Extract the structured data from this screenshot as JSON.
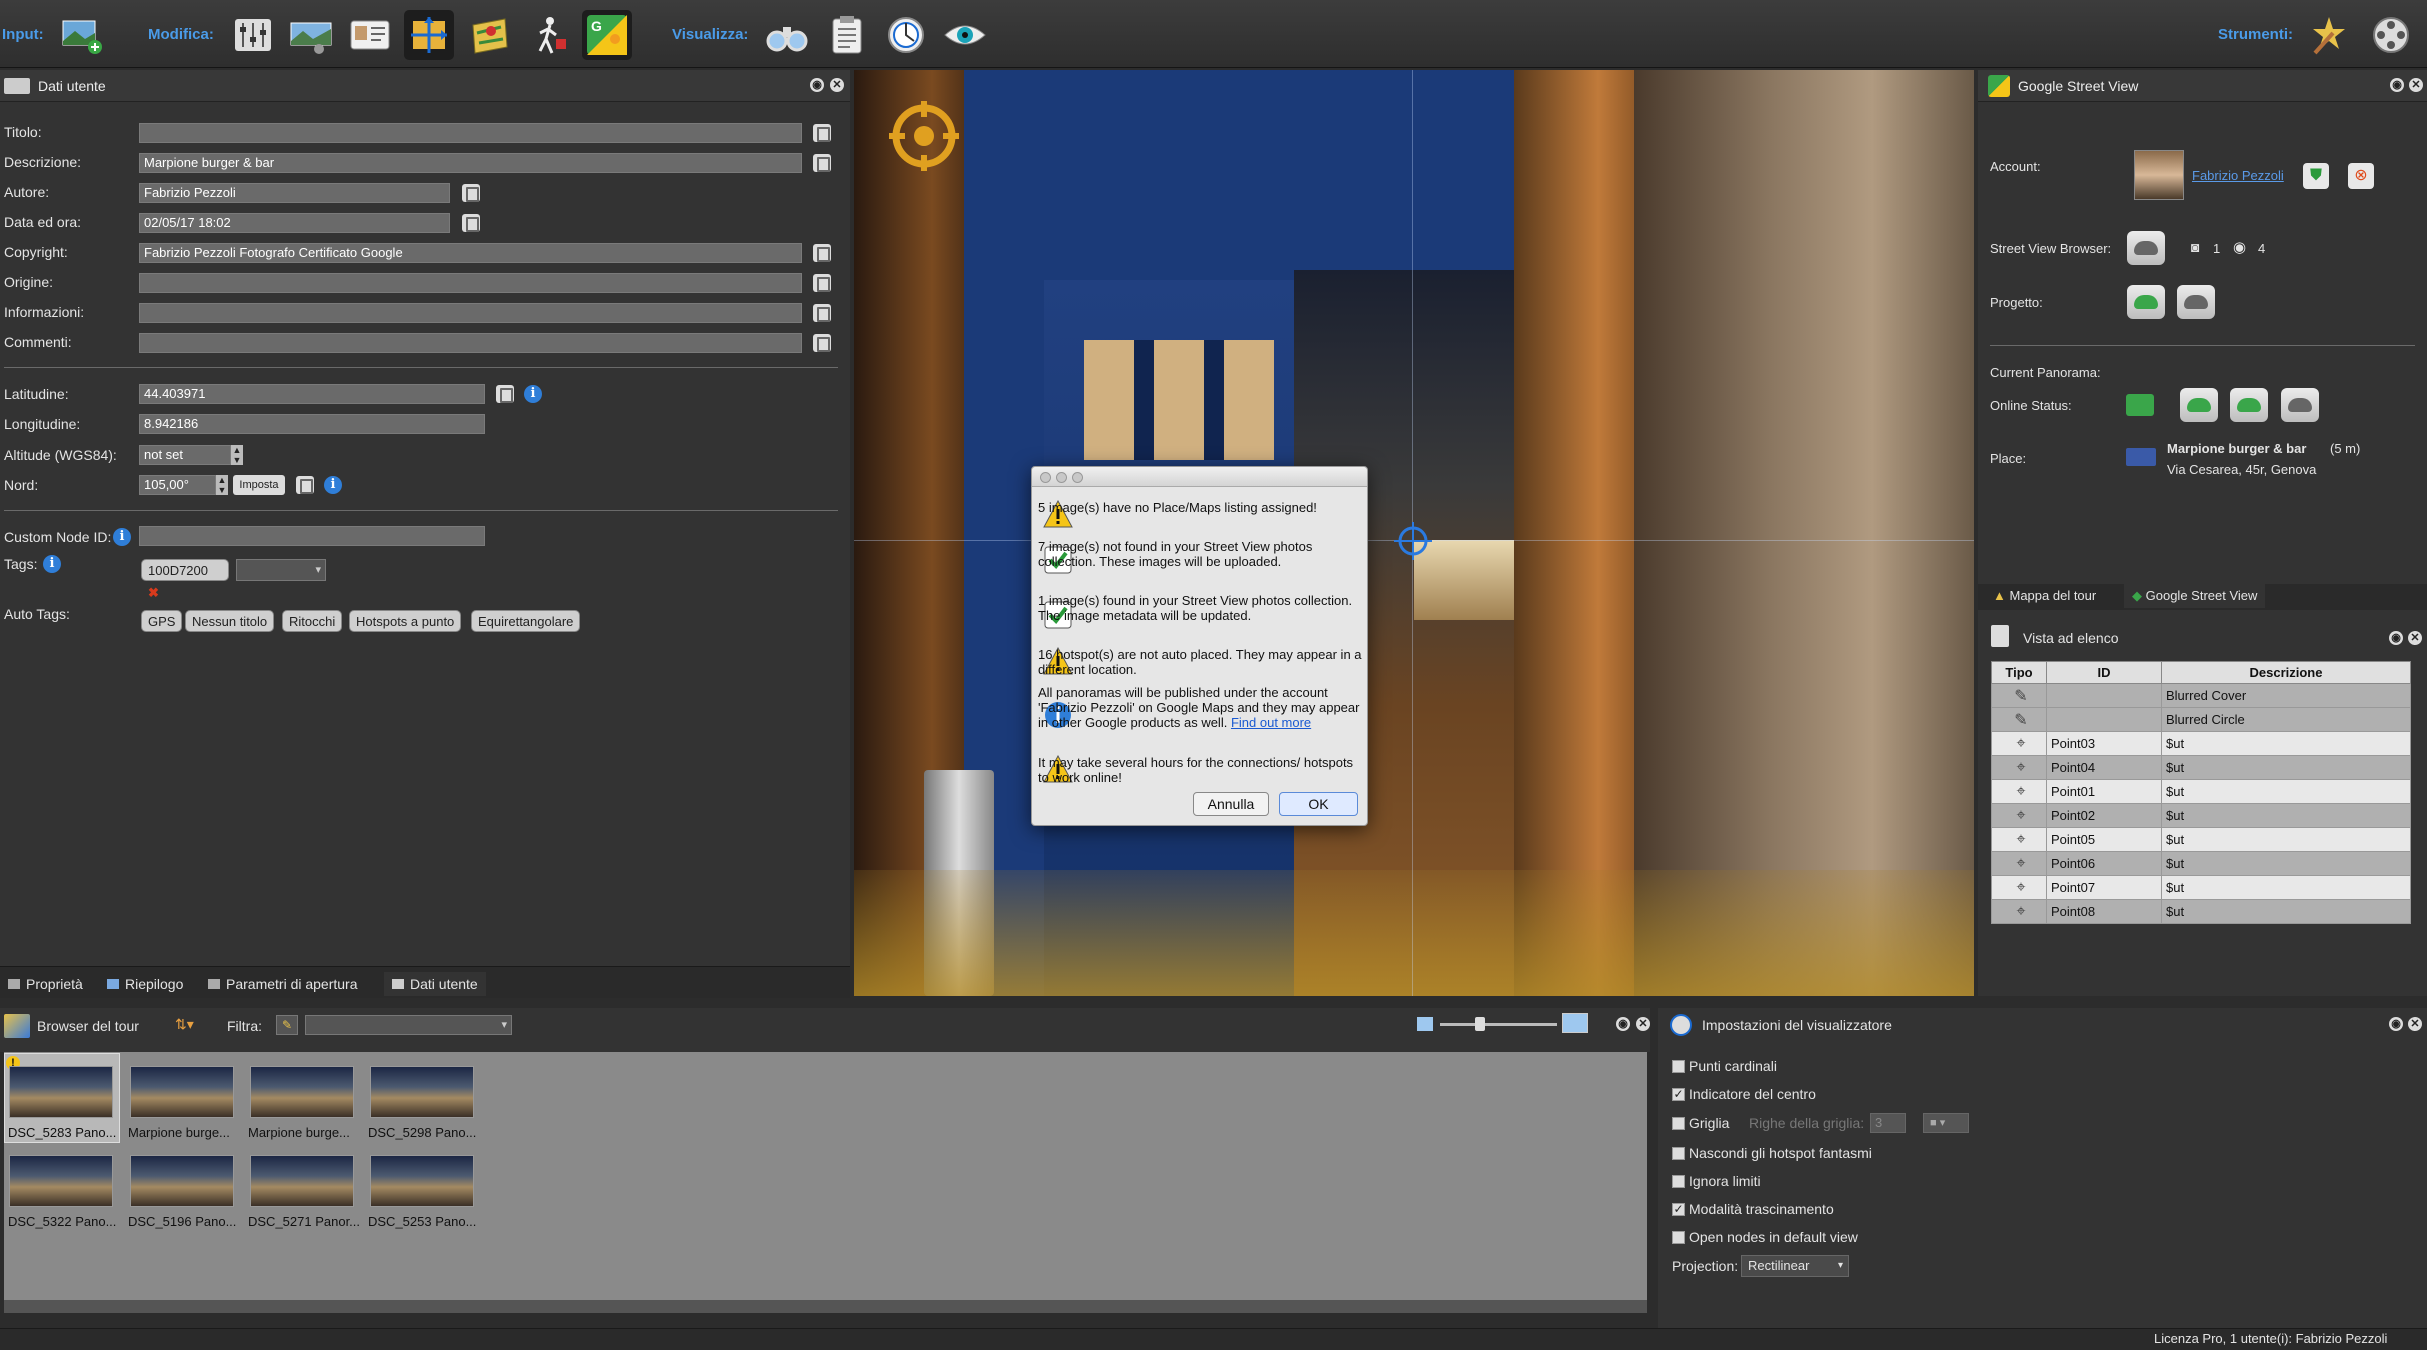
{
  "toolbar": {
    "input_label": "Input:",
    "modifica_label": "Modifica:",
    "visualizza_label": "Visualizza:",
    "strumenti_label": "Strumenti:"
  },
  "left_panel": {
    "title": "Dati utente",
    "fields": {
      "titolo": {
        "label": "Titolo:",
        "value": ""
      },
      "descrizione": {
        "label": "Descrizione:",
        "value": "Marpione burger & bar"
      },
      "autore": {
        "label": "Autore:",
        "value": "Fabrizio Pezzoli"
      },
      "data": {
        "label": "Data ed ora:",
        "value": "02/05/17 18:02"
      },
      "copyright": {
        "label": "Copyright:",
        "value": "Fabrizio Pezzoli Fotografo Certificato Google"
      },
      "origine": {
        "label": "Origine:",
        "value": ""
      },
      "informazioni": {
        "label": "Informazioni:",
        "value": ""
      },
      "commenti": {
        "label": "Commenti:",
        "value": ""
      },
      "latitudine": {
        "label": "Latitudine:",
        "value": "44.403971"
      },
      "longitudine": {
        "label": "Longitudine:",
        "value": "8.942186"
      },
      "altitude": {
        "label": "Altitude (WGS84):",
        "value": "not set"
      },
      "nord": {
        "label": "Nord:",
        "value": "105,00°",
        "button": "Imposta"
      },
      "custom_node": {
        "label": "Custom Node ID:",
        "value": ""
      },
      "tags": {
        "label": "Tags:",
        "tag": "100D7200"
      },
      "auto_tags": {
        "label": "Auto Tags:",
        "items": [
          "GPS",
          "Nessun titolo",
          "Ritocchi",
          "Hotspots a punto",
          "Equirettangolare"
        ]
      }
    },
    "tabs": [
      "Proprietà",
      "Riepilogo",
      "Parametri di apertura",
      "Dati utente"
    ]
  },
  "dialog": {
    "messages": [
      "5 image(s) have no Place/Maps listing assigned!",
      "7 image(s) not found in your Street View photos collection. These images will be uploaded.",
      "1 image(s) found in your Street View photos collection. The image metadata will be updated.",
      "16 hotspot(s) are not auto placed. They may appear in a different location.",
      "All panoramas will be published under the account 'Fabrizio Pezzoli' on Google Maps and they may appear in other Google products as well.",
      "It may take several hours for the connections/ hotspots to work online!"
    ],
    "link": "Find out more",
    "account": "Fabrizio Pezzoli",
    "cancel": "Annulla",
    "ok": "OK"
  },
  "right_panel": {
    "title": "Google Street View",
    "account_label": "Account:",
    "account_name": "Fabrizio Pezzoli",
    "browser_label": "Street View Browser:",
    "photo_count": "1",
    "view_count": "4",
    "progetto_label": "Progetto:",
    "current_label": "Current Panorama:",
    "online_label": "Online Status:",
    "place_label": "Place:",
    "place_name": "Marpione burger & bar",
    "place_dist": "(5 m)",
    "place_addr": "Via Cesarea, 45r, Genova",
    "tabs": [
      "Mappa del tour",
      "Google Street View"
    ],
    "list_title": "Vista ad elenco",
    "columns": [
      "Tipo",
      "ID",
      "Descrizione"
    ],
    "rows": [
      {
        "tipo": "pencil",
        "id": "",
        "desc": "Blurred Cover"
      },
      {
        "tipo": "pencil",
        "id": "",
        "desc": "Blurred Circle"
      },
      {
        "tipo": "point",
        "id": "Point03",
        "desc": "$ut"
      },
      {
        "tipo": "point",
        "id": "Point04",
        "desc": "$ut"
      },
      {
        "tipo": "point",
        "id": "Point01",
        "desc": "$ut"
      },
      {
        "tipo": "point",
        "id": "Point02",
        "desc": "$ut"
      },
      {
        "tipo": "point",
        "id": "Point05",
        "desc": "$ut"
      },
      {
        "tipo": "point",
        "id": "Point06",
        "desc": "$ut"
      },
      {
        "tipo": "point",
        "id": "Point07",
        "desc": "$ut"
      },
      {
        "tipo": "point",
        "id": "Point08",
        "desc": "$ut"
      }
    ]
  },
  "browser": {
    "title": "Browser del tour",
    "filter_label": "Filtra:",
    "thumbs": [
      "DSC_5283 Pano...",
      "Marpione burge...",
      "Marpione burge...",
      "DSC_5298 Pano...",
      "DSC_5322 Pano...",
      "DSC_5196 Pano...",
      "DSC_5271 Panor...",
      "DSC_5253 Pano..."
    ]
  },
  "viewer_settings": {
    "title": "Impostazioni del visualizzatore",
    "options": [
      {
        "label": "Punti cardinali",
        "checked": false
      },
      {
        "label": "Indicatore del centro",
        "checked": true
      },
      {
        "label": "Griglia",
        "checked": false
      },
      {
        "label": "Nascondi gli hotspot fantasmi",
        "checked": false
      },
      {
        "label": "Ignora limiti",
        "checked": false
      },
      {
        "label": "Modalità trascinamento",
        "checked": true
      },
      {
        "label": "Open nodes in default view",
        "checked": false
      }
    ],
    "grid_rows_label": "Righe della griglia:",
    "grid_rows_value": "3",
    "projection_label": "Projection:",
    "projection_value": "Rectilinear"
  },
  "status_bar": "Licenza Pro,  1 utente(i): Fabrizio Pezzoli"
}
